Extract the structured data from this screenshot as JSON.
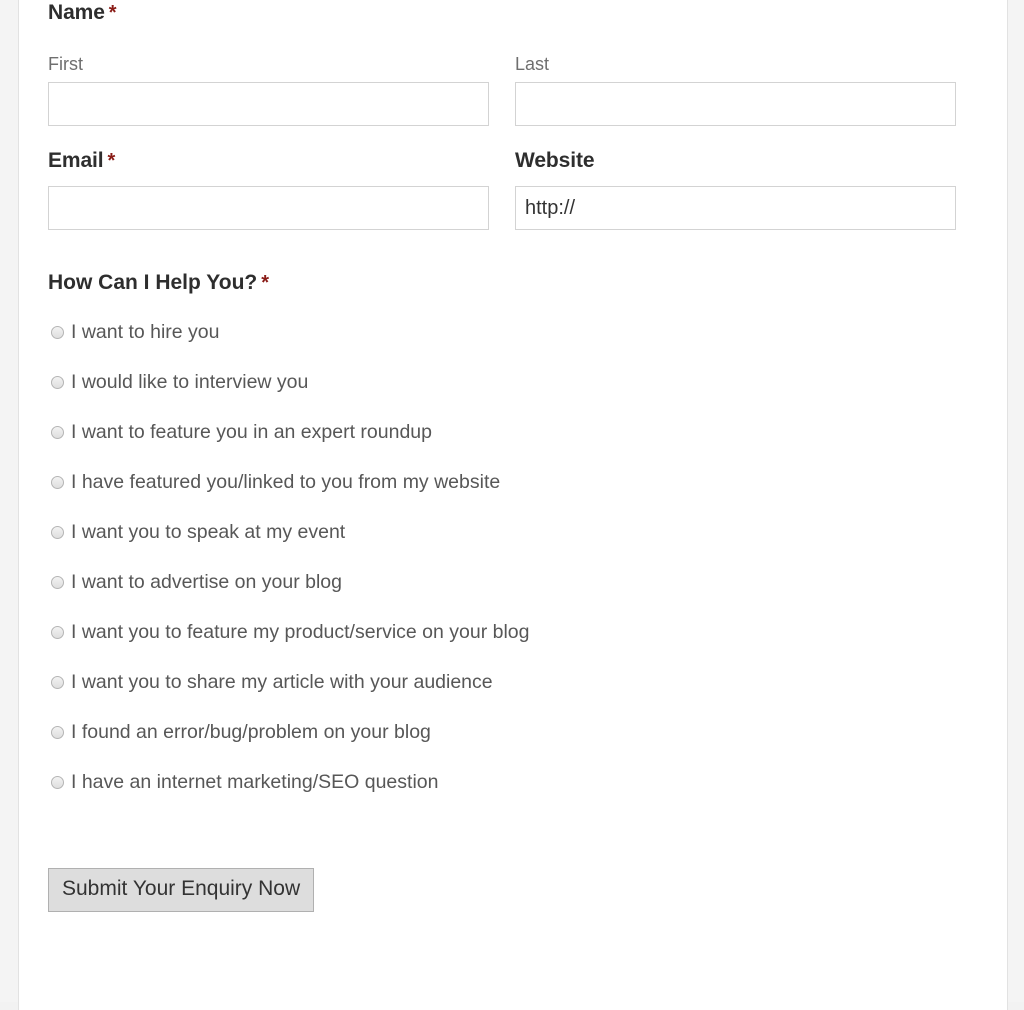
{
  "form": {
    "name_group": {
      "label": "Name",
      "required_marker": "*",
      "first": {
        "label": "First",
        "value": "",
        "placeholder": ""
      },
      "last": {
        "label": "Last",
        "value": "",
        "placeholder": ""
      }
    },
    "contact_group": {
      "email": {
        "label": "Email",
        "required_marker": "*",
        "value": "",
        "placeholder": ""
      },
      "website": {
        "label": "Website",
        "required_marker": "",
        "value": "http://",
        "placeholder": ""
      }
    },
    "help_group": {
      "label": "How Can I Help You?",
      "required_marker": "*",
      "options": [
        {
          "label": "I want to hire you",
          "selected": false
        },
        {
          "label": "I would like to interview you",
          "selected": false
        },
        {
          "label": "I want to feature you in an expert roundup",
          "selected": false
        },
        {
          "label": "I have featured you/linked to you from my website",
          "selected": false
        },
        {
          "label": "I want you to speak at my event",
          "selected": false
        },
        {
          "label": "I want to advertise on your blog",
          "selected": false
        },
        {
          "label": "I want you to feature my product/service on your blog",
          "selected": false
        },
        {
          "label": "I want you to share my article with your audience",
          "selected": false
        },
        {
          "label": "I found an error/bug/problem on your blog",
          "selected": false
        },
        {
          "label": "I have an internet marketing/SEO question",
          "selected": false
        }
      ]
    },
    "submit": {
      "label": "Submit Your Enquiry Now"
    }
  },
  "colors": {
    "required_star": "#8a1c17",
    "heading_text": "#2e2e2e",
    "sub_label_text": "#6f6f6f",
    "option_text": "#575757",
    "input_border": "#d3d3d3",
    "page_background": "#f4f4f4",
    "sheet_background": "#ffffff",
    "button_background": "#dddddd",
    "button_border": "#b0b0b0"
  }
}
